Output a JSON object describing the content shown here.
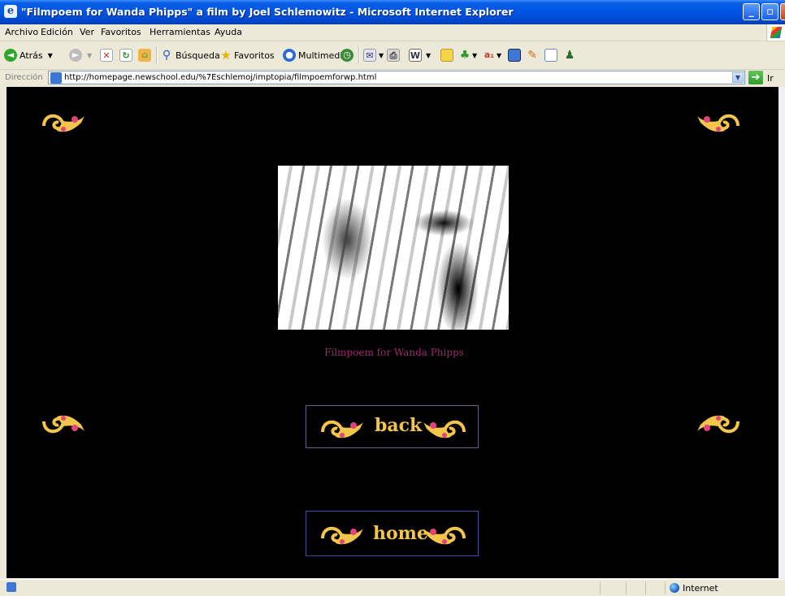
{
  "window": {
    "title": "\"Filmpoem for Wanda Phipps\" a film by Joel Schlemowitz - Microsoft Internet Explorer"
  },
  "menu": [
    "Archivo",
    "Edición",
    "Ver",
    "Favoritos",
    "Herramientas",
    "Ayuda"
  ],
  "toolbar": {
    "back": "Atrás",
    "search": "Búsqueda",
    "favorites": "Favoritos",
    "media": "Multimedia"
  },
  "address": {
    "label": "Dirección",
    "url": "http://homepage.newschool.edu/%7Eschlemoj/imptopia/filmpoemforwp.html",
    "go": "Ir"
  },
  "page": {
    "film_title": "Filmpoem for Wanda Phipps",
    "back_label": "back",
    "home_label": "home"
  },
  "status": {
    "zone": "Internet"
  },
  "colors": {
    "page_background": "#000000",
    "ornament_gold": "#f3c54a",
    "ornament_pink": "#e0447a",
    "title_text": "#9c2a6e"
  }
}
